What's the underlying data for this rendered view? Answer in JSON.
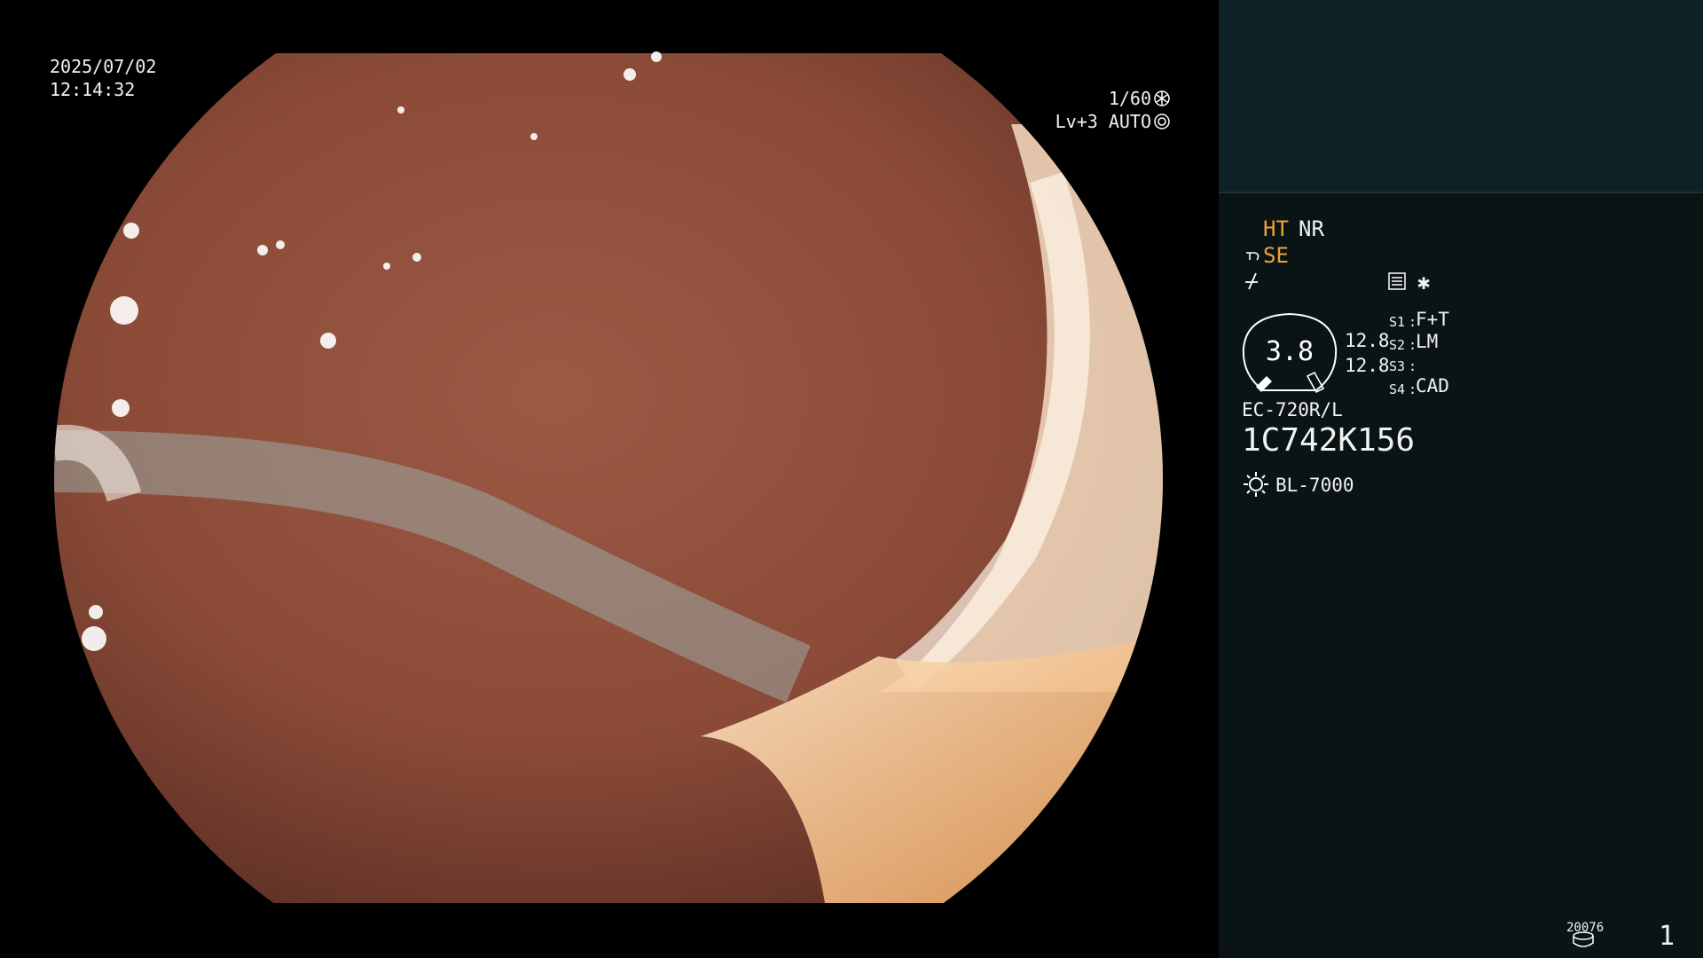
{
  "overlay": {
    "date": "2025/07/02",
    "time": "12:14:32",
    "shutter": "1/60",
    "iris": "Lv+3 AUTO"
  },
  "panel": {
    "enhancement": [
      "HT",
      "NR"
    ],
    "structure_label": "SE",
    "zoom_value": "3.8",
    "zoom_a": "12.8",
    "zoom_b": "12.8",
    "switches": [
      {
        "key": "S1",
        "value": "F+T"
      },
      {
        "key": "S2",
        "value": "LM"
      },
      {
        "key": "S3",
        "value": ""
      },
      {
        "key": "S4",
        "value": "CAD"
      }
    ],
    "scope_model": "EC-720R/L",
    "scope_serial": "1C742K156",
    "light_source": "BL-7000",
    "record_count": "20076",
    "page_number": "1"
  },
  "icons": [
    "shutter-icon",
    "iris-icon",
    "structure-enhance-icon",
    "freeze-icon",
    "memo-icon",
    "star-icon",
    "light-source-icon",
    "disk-icon"
  ],
  "colors": {
    "accent": "#f0a23a",
    "panel_bg": "#0a1414",
    "preview_bg": "#0d2226"
  }
}
